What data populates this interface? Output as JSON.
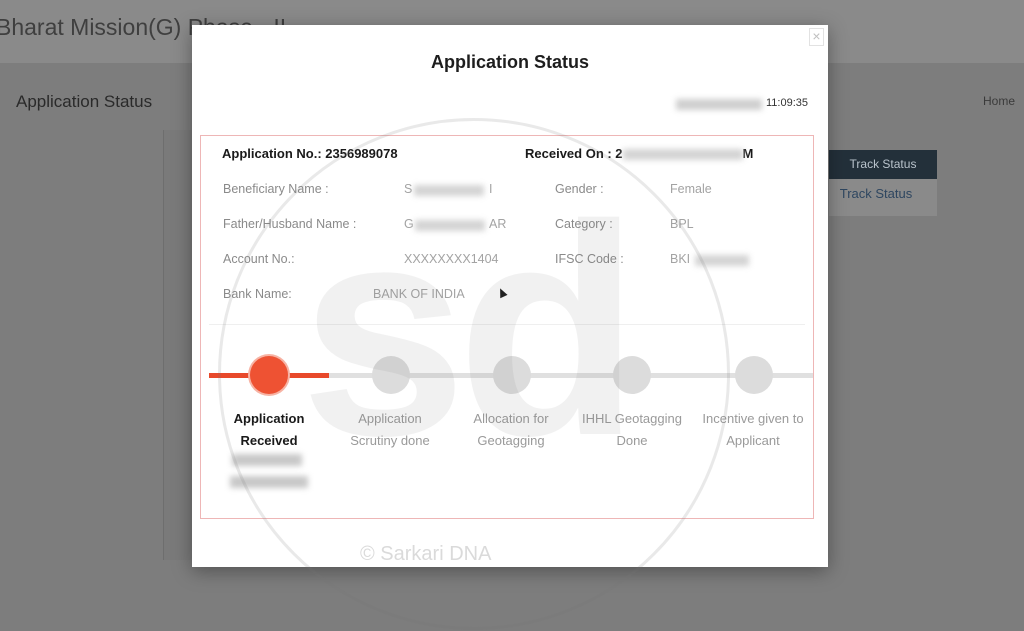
{
  "background": {
    "site_title": "Bharat Mission(G) Phase - II",
    "page_heading": "Application Status",
    "home_link": "Home",
    "side_menu": [
      "Track Status",
      "Track Status"
    ]
  },
  "modal": {
    "title": "Application Status",
    "close_icon": "×",
    "timestamp_visible": "11:09:35",
    "application_no": "Application No.: 2356989078",
    "received_on_label": "Received On : 2",
    "received_on_suffix": "M",
    "fields": {
      "beneficiary_name_label": "Beneficiary Name :",
      "beneficiary_name_value": "S",
      "beneficiary_name_tail": "I",
      "gender_label": "Gender :",
      "gender_value": "Female",
      "father_label": "Father/Husband Name :",
      "father_value": "G",
      "father_tail": "AR",
      "category_label": "Category :",
      "category_value": "BPL",
      "account_label": "Account No.:",
      "account_value": "XXXXXXXX1404",
      "ifsc_label": "IFSC Code :",
      "ifsc_value": "BKI",
      "bank_label": "Bank Name:",
      "bank_value": "BANK OF INDIA"
    },
    "steps": [
      {
        "line1": "Application",
        "line2": "Received",
        "active": true
      },
      {
        "line1": "Application",
        "line2": "Scrutiny done",
        "active": false
      },
      {
        "line1": "Allocation for",
        "line2": "Geotagging",
        "active": false
      },
      {
        "line1": "IHHL Geotagging",
        "line2": "Done",
        "active": false
      },
      {
        "line1": "Incentive given to",
        "line2": "Applicant",
        "active": false
      }
    ]
  },
  "watermark": {
    "letters": "sd",
    "brand": "© Sarkari DNA"
  },
  "colors": {
    "accent": "#ee5233",
    "inactive_step": "#dcdcdc",
    "border": "#eeb6b6"
  }
}
